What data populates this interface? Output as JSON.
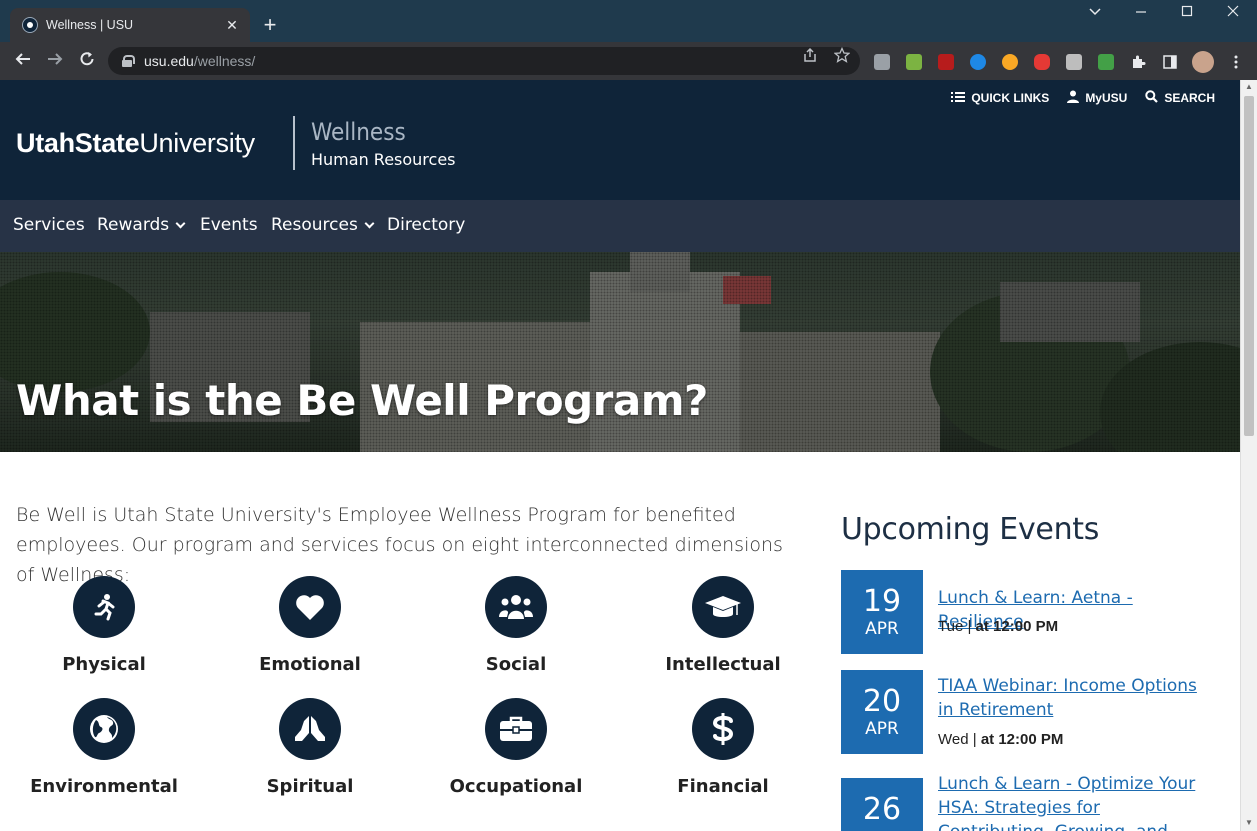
{
  "browser": {
    "tab_title": "Wellness | USU",
    "tab_close": "✕",
    "new_tab": "+",
    "url_host": "usu.edu",
    "url_path": "/wellness/",
    "window_controls": [
      "minimize",
      "maximize",
      "close"
    ]
  },
  "header": {
    "utility": [
      {
        "label": "QUICK LINKS",
        "icon": "list-icon"
      },
      {
        "label": "MyUSU",
        "icon": "user-icon"
      },
      {
        "label": "SEARCH",
        "icon": "search-icon"
      }
    ],
    "logo_bold": "UtahState",
    "logo_light": "University",
    "site_title": "Wellness",
    "site_subtitle": "Human Resources"
  },
  "nav": {
    "items": [
      {
        "label": "Services",
        "dropdown": false
      },
      {
        "label": "Rewards",
        "dropdown": true
      },
      {
        "label": "Events",
        "dropdown": false
      },
      {
        "label": "Resources",
        "dropdown": true
      },
      {
        "label": "Directory",
        "dropdown": false
      }
    ]
  },
  "hero": {
    "title": "What is the Be Well Program?"
  },
  "intro": "Be Well is Utah State University's Employee Wellness Program for benefited employees. Our program and services focus on eight interconnected dimensions of Wellness:",
  "dimensions": [
    {
      "label": "Physical",
      "icon": "running-person-icon"
    },
    {
      "label": "Emotional",
      "icon": "heart-icon"
    },
    {
      "label": "Social",
      "icon": "people-group-icon"
    },
    {
      "label": "Intellectual",
      "icon": "graduation-cap-icon"
    },
    {
      "label": "Environmental",
      "icon": "globe-icon"
    },
    {
      "label": "Spiritual",
      "icon": "praying-hands-icon"
    },
    {
      "label": "Occupational",
      "icon": "briefcase-icon"
    },
    {
      "label": "Financial",
      "icon": "dollar-icon"
    }
  ],
  "events": {
    "heading": "Upcoming Events",
    "items": [
      {
        "day": "19",
        "month": "APR",
        "title": "Lunch & Learn: Aetna - Resilience",
        "weekday": "Tue",
        "separator": "|",
        "time": "at 12:00 PM"
      },
      {
        "day": "20",
        "month": "APR",
        "title": "TIAA Webinar: Income Options in Retirement",
        "weekday": "Wed",
        "separator": "|",
        "time": "at 12:00 PM"
      },
      {
        "day": "26",
        "month": "",
        "title": "Lunch & Learn - Optimize Your HSA: Strategies for Contributing, Growing, and Withdrawing Your HSA Funds",
        "weekday": "",
        "separator": "",
        "time": ""
      }
    ]
  },
  "colors": {
    "header_bg": "#0f2439",
    "nav_bg": "#273346",
    "accent_blue": "#1d6bb0",
    "icon_circle": "#0f2439"
  }
}
